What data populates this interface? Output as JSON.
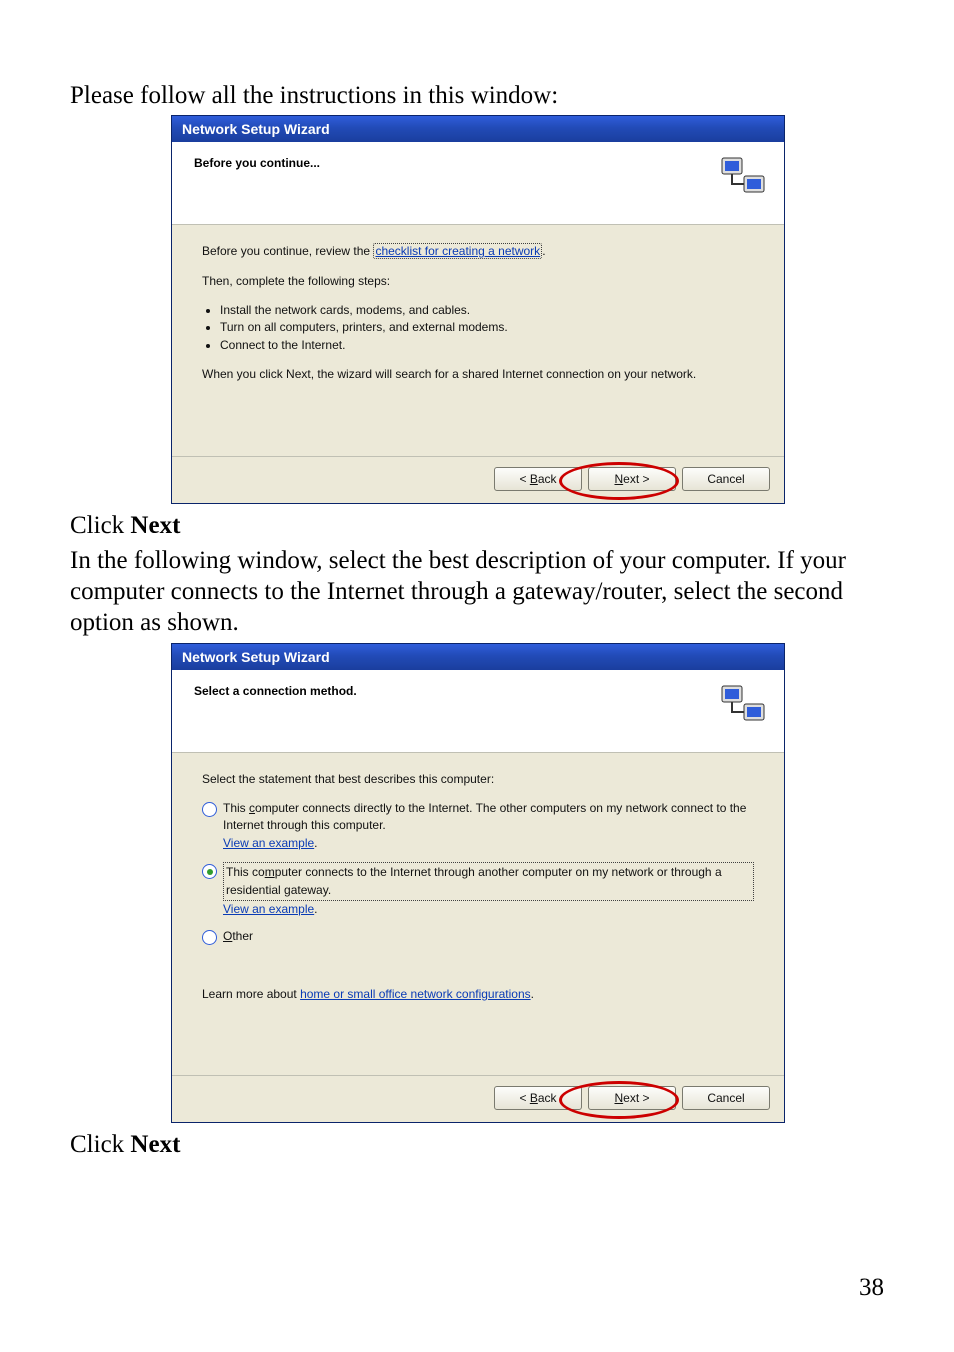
{
  "intro_text": "Please follow all the instructions in this window:",
  "wizard1": {
    "title": "Network Setup Wizard",
    "header": "Before you continue...",
    "line_before_prefix": "Before you continue, review the ",
    "line_before_link": "checklist for creating a network",
    "line_before_suffix": ".",
    "then_line": "Then, complete the following steps:",
    "steps": [
      "Install the network cards, modems, and cables.",
      "Turn on all computers, printers, and external modems.",
      "Connect to the Internet."
    ],
    "search_line": "When you click Next, the wizard will search for a shared Internet connection on your network.",
    "buttons": {
      "back": "< Back",
      "next": "Next >",
      "cancel": "Cancel"
    }
  },
  "mid_text": {
    "line1_prefix": "Click ",
    "line1_bold": "Next",
    "para": "In the following window, select the best description of your computer.  If your computer connects to the Internet through a gateway/router, select the second option as shown."
  },
  "wizard2": {
    "title": "Network Setup Wizard",
    "header": "Select a connection method.",
    "select_line": "Select the statement that best describes this computer:",
    "opt1": {
      "text": "This computer connects directly to the Internet. The other computers on my network connect to the Internet through this computer.",
      "example": "View an example",
      "underline_letter": "c",
      "selected": false
    },
    "opt2": {
      "text_a": "This co",
      "text_m": "m",
      "text_b": "puter connects to the Internet through another computer on my network or through a residential gateway.",
      "example": "View an example",
      "selected": true
    },
    "opt3": {
      "text": "Other",
      "underline_letter": "O",
      "selected": false
    },
    "learn_prefix": "Learn more about ",
    "learn_link": "home or small office network configurations",
    "learn_suffix": ".",
    "buttons": {
      "back": "< Back",
      "next": "Next >",
      "cancel": "Cancel"
    }
  },
  "end_text": {
    "line_prefix": "Click ",
    "line_bold": "Next"
  },
  "page_number": "38"
}
